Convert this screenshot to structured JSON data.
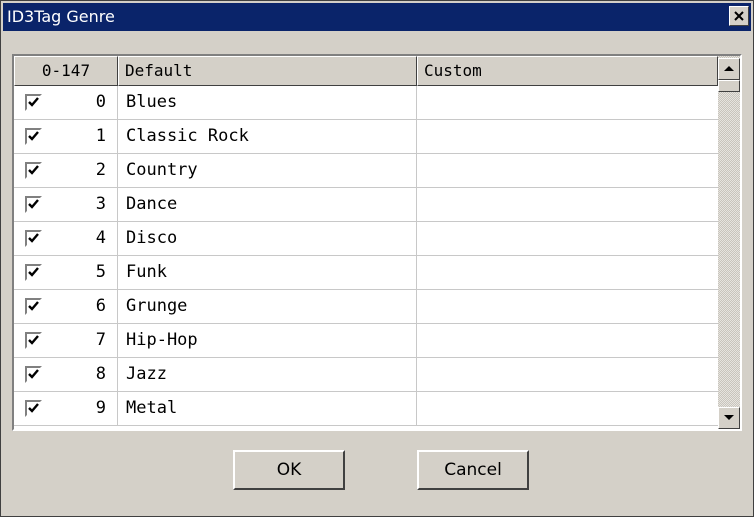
{
  "window": {
    "title": "ID3Tag Genre",
    "close_icon": "close-icon"
  },
  "columns": {
    "number": "0-147",
    "default": "Default",
    "custom": "Custom"
  },
  "rows": [
    {
      "checked": true,
      "num": "0",
      "default": "Blues",
      "custom": ""
    },
    {
      "checked": true,
      "num": "1",
      "default": "Classic Rock",
      "custom": ""
    },
    {
      "checked": true,
      "num": "2",
      "default": "Country",
      "custom": ""
    },
    {
      "checked": true,
      "num": "3",
      "default": "Dance",
      "custom": ""
    },
    {
      "checked": true,
      "num": "4",
      "default": "Disco",
      "custom": ""
    },
    {
      "checked": true,
      "num": "5",
      "default": "Funk",
      "custom": ""
    },
    {
      "checked": true,
      "num": "6",
      "default": "Grunge",
      "custom": ""
    },
    {
      "checked": true,
      "num": "7",
      "default": "Hip-Hop",
      "custom": ""
    },
    {
      "checked": true,
      "num": "8",
      "default": "Jazz",
      "custom": ""
    },
    {
      "checked": true,
      "num": "9",
      "default": "Metal",
      "custom": ""
    }
  ],
  "buttons": {
    "ok": "OK",
    "cancel": "Cancel"
  },
  "colors": {
    "titlebar": "#0a246a",
    "face": "#d4d0c8"
  }
}
